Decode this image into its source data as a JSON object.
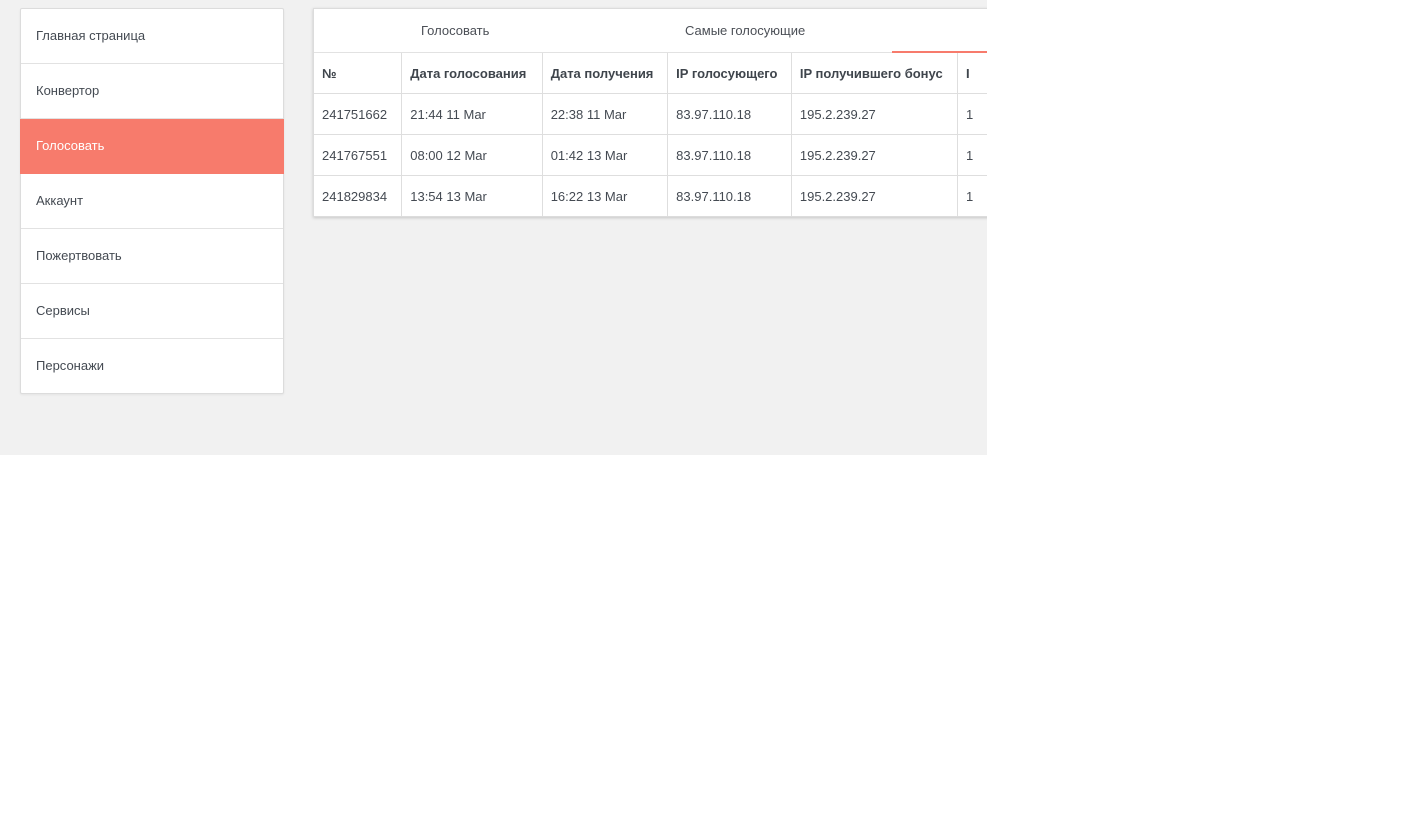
{
  "sidebar": {
    "items": [
      {
        "label": "Главная страница"
      },
      {
        "label": "Конвертор"
      },
      {
        "label": "Голосовать",
        "active": true
      },
      {
        "label": "Аккаунт"
      },
      {
        "label": "Пожертвовать"
      },
      {
        "label": "Сервисы"
      },
      {
        "label": "Персонажи"
      }
    ]
  },
  "tabs": [
    {
      "label": "Голосовать"
    },
    {
      "label": "Самые голосующие"
    }
  ],
  "table": {
    "headers": [
      "№",
      "Дата голосования",
      "Дата получения",
      "IP голосующего",
      "IP получившего бонус",
      "I"
    ],
    "rows": [
      [
        "241751662",
        "21:44 11 Mar",
        "22:38 11 Mar",
        "83.97.110.18",
        "195.2.239.27",
        "1"
      ],
      [
        "241767551",
        "08:00 12 Mar",
        "01:42 13 Mar",
        "83.97.110.18",
        "195.2.239.27",
        "1"
      ],
      [
        "241829834",
        "13:54 13 Mar",
        "16:22 13 Mar",
        "83.97.110.18",
        "195.2.239.27",
        "1"
      ]
    ]
  },
  "colors": {
    "accent": "#f77b6c",
    "background": "#f1f1f1"
  }
}
